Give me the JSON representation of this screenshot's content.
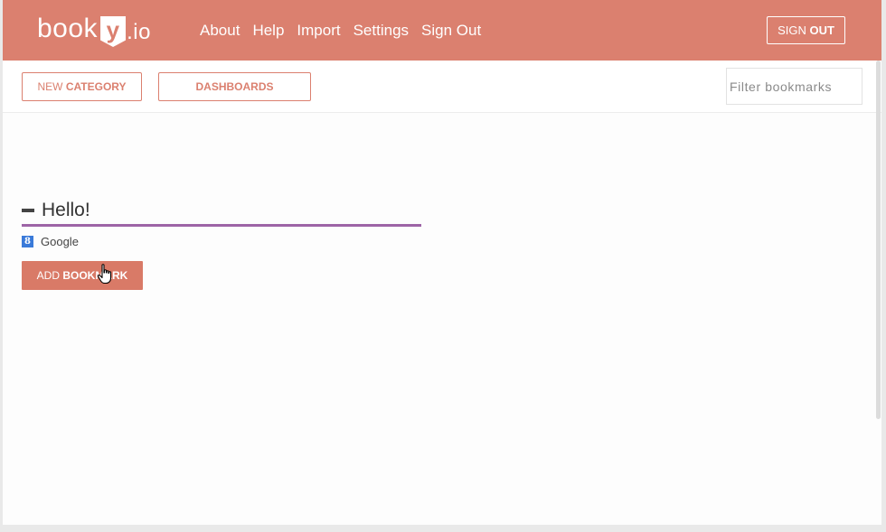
{
  "header": {
    "logo_book": "book",
    "logo_y": "y",
    "logo_io": ".io",
    "nav": [
      "About",
      "Help",
      "Import",
      "Settings",
      "Sign Out"
    ],
    "signout_light": "SIGN ",
    "signout_bold": "OUT"
  },
  "toolbar": {
    "new_light": "NEW ",
    "new_bold": "CATEGORY",
    "dashboards": "DASHBOARDS",
    "filter_placeholder": "Filter bookmarks"
  },
  "category": {
    "title": "Hello!",
    "bookmarks": [
      {
        "favicon": "8",
        "label": "Google"
      }
    ],
    "add_light": "ADD ",
    "add_bold": "BOOKMARK"
  },
  "colors": {
    "brand": "#db806f",
    "category_underline": "#9d64a6",
    "favicon_bg": "#3a7ad9"
  },
  "icons": {
    "collapse": "minus-icon",
    "favicon": "google-favicon-icon",
    "cursor": "hand-pointer-cursor-icon"
  }
}
